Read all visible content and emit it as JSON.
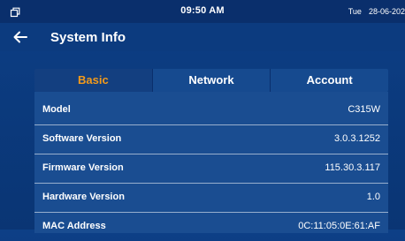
{
  "status_bar": {
    "time": "09:50 AM",
    "day": "Tue",
    "date": "28-06-202"
  },
  "header": {
    "title": "System Info"
  },
  "tabs": [
    {
      "label": "Basic",
      "active": true
    },
    {
      "label": "Network",
      "active": false
    },
    {
      "label": "Account",
      "active": false
    }
  ],
  "info_rows": [
    {
      "label": "Model",
      "value": "C315W"
    },
    {
      "label": "Software Version",
      "value": "3.0.3.1252"
    },
    {
      "label": "Firmware Version",
      "value": "115.30.3.117"
    },
    {
      "label": "Hardware Version",
      "value": "1.0"
    },
    {
      "label": "MAC Address",
      "value": "0C:11:05:0E:61:AF"
    }
  ],
  "colors": {
    "background": "#0b3a7d",
    "status_bar": "#0a2f6c",
    "panel": "#1a4d91",
    "active_tab": "#f39a1a",
    "text": "#ffffff"
  },
  "icons": {
    "status_left": "window-restore-icon",
    "back": "back-arrow-icon"
  }
}
